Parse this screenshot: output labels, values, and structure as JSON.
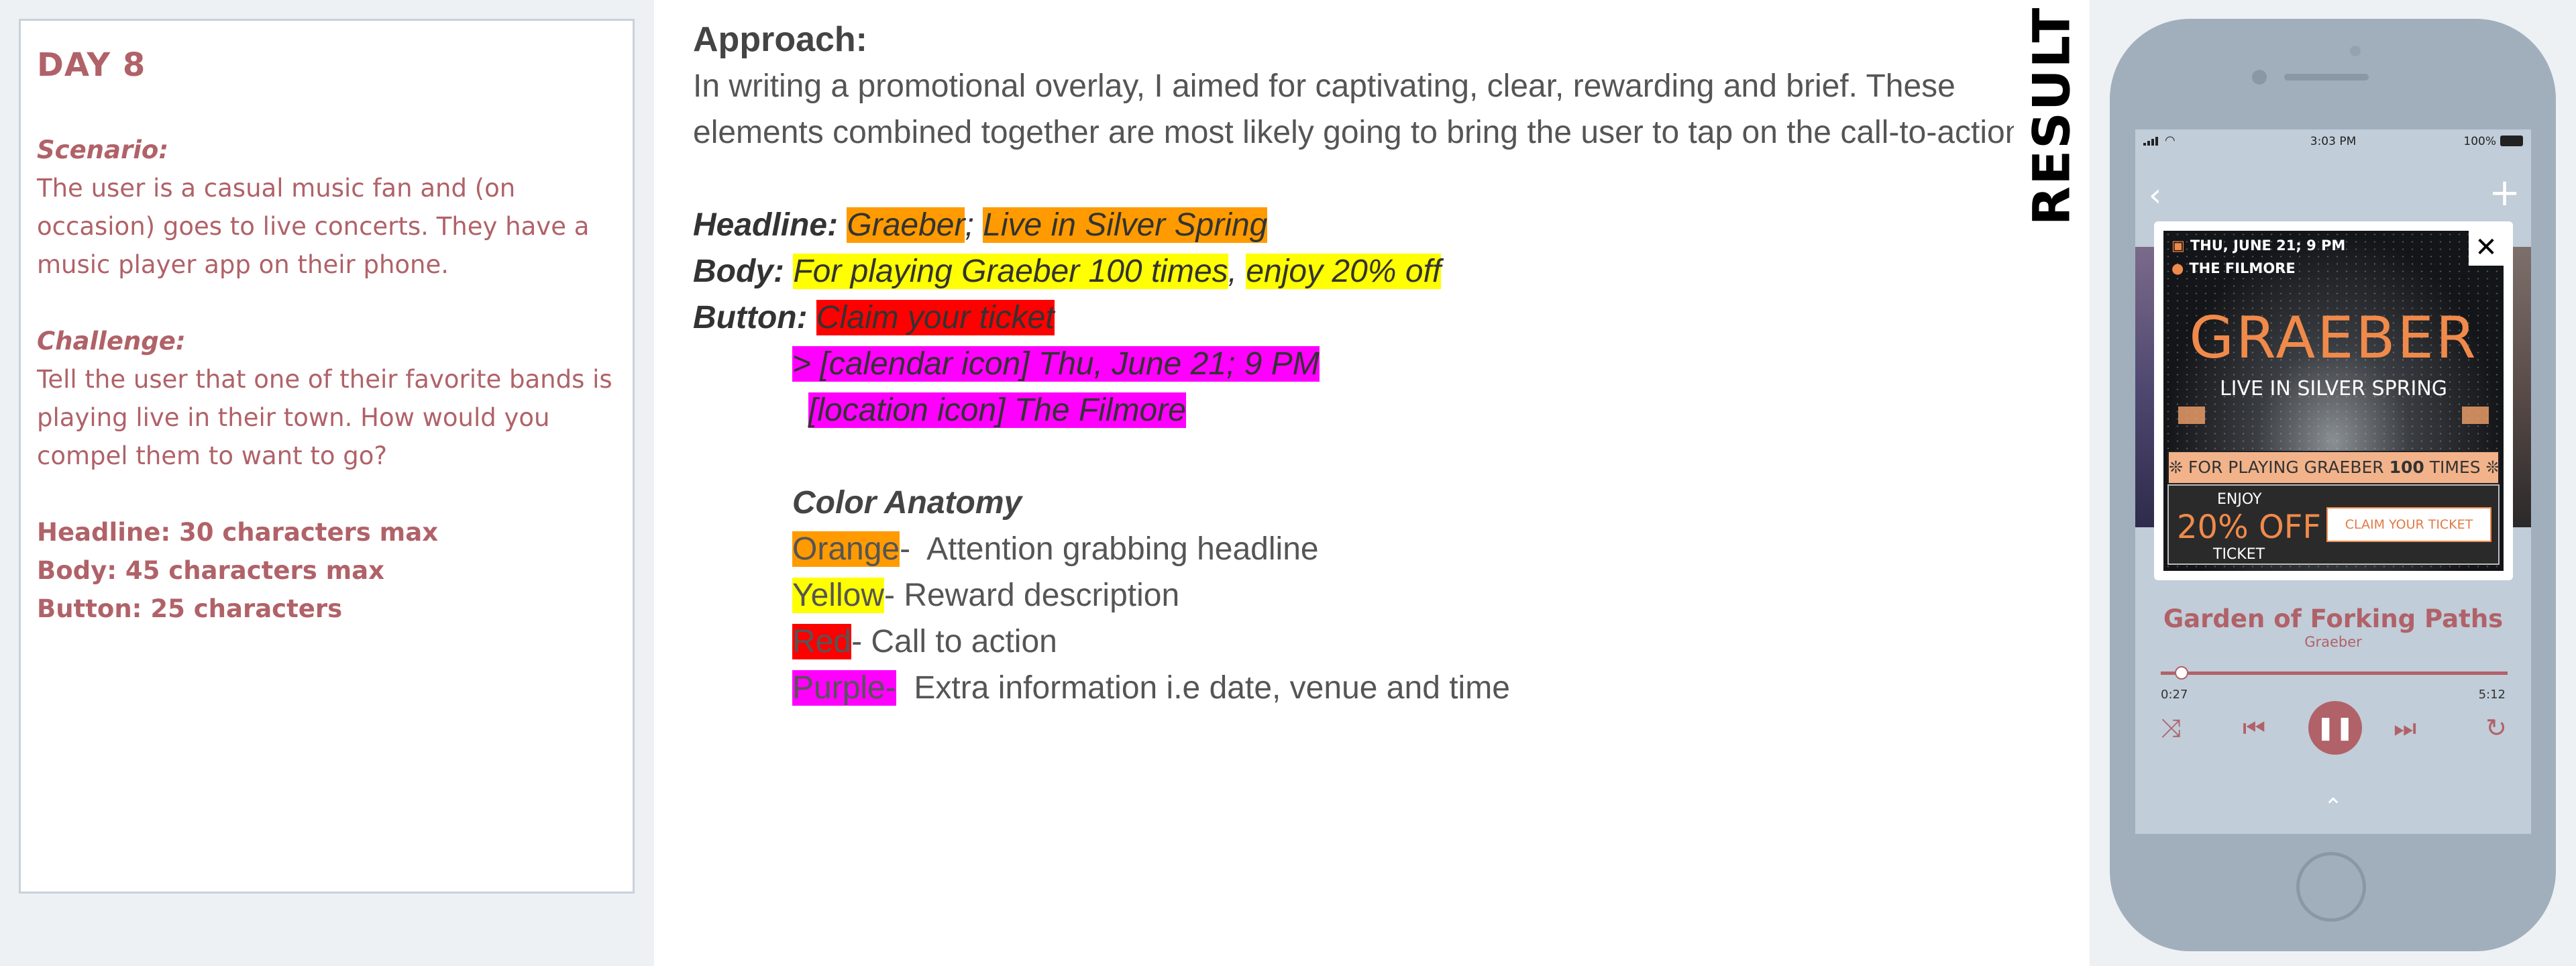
{
  "brief": {
    "day": "DAY 8",
    "scenario_heading": "Scenario:",
    "scenario_text": "The user is a casual music fan and (on occasion) goes to live concerts. They have a music player app on their phone.",
    "challenge_heading": "Challenge:",
    "challenge_text": "Tell the user that one of their favorite bands is playing live in their town. How would you compel them to want to go?",
    "headline_req": "Headline: 30 characters max",
    "body_req": "Body: 45 characters max",
    "button_req": "Button: 25 characters"
  },
  "approach": {
    "title": "Approach:",
    "intro": "In writing a promotional overlay, I aimed for captivating, clear, rewarding and brief. These elements combined together are most likely going to bring the user to tap on the call-to-action.",
    "headline_label": "Headline:",
    "headline_part1": "Graeber",
    "headline_sep": ";",
    "headline_part2": "Live in Silver Spring",
    "body_label": "Body:",
    "body_part1": "For playing Graeber 100 times",
    "body_sep": ",",
    "body_part2": "enjoy 20% off",
    "button_label": "Button:",
    "button_text": "Claim your ticket",
    "extra1": "> [calendar icon] Thu, June 21; 9 PM",
    "extra2": "[location icon] The Filmore",
    "anatomy_title": "Color Anatomy",
    "anatomy": [
      {
        "swatch": "Orange",
        "sep": "-",
        "desc": "  Attention grabbing headline",
        "color": "#ff9b00"
      },
      {
        "swatch": "Yellow",
        "sep": "-",
        "desc": " Reward description",
        "color": "#ffff00"
      },
      {
        "swatch": "Red",
        "sep": "-",
        "desc": " Call to action",
        "color": "#ff0000"
      },
      {
        "swatch": "Purple",
        "sep": "-",
        "desc": "  Extra information i.e date, venue and time",
        "color": "#ff00ff"
      }
    ]
  },
  "result_label": "RESULT",
  "phone": {
    "status_time": "3:03 PM",
    "battery": "100%",
    "overlay": {
      "date": "THU, JUNE 21; 9 PM",
      "venue": "THE FILMORE",
      "band": "GRAEBER",
      "subtitle": "LIVE IN SILVER SPRING",
      "offer_prefix": "FOR PLAYING GRAEBER ",
      "offer_count": "100",
      "offer_suffix": " TIMES",
      "enjoy": "ENJOY",
      "percent": "20% OFF",
      "ticket": "TICKET",
      "cta": "CLAIM YOUR TICKET",
      "close": "✕"
    },
    "song_title": "Garden of Forking Paths",
    "song_artist": "Graeber",
    "elapsed": "0:27",
    "duration": "5:12",
    "progress": 0.06
  },
  "colors": {
    "accent": "#b06268",
    "overlay_accent": "#f08a4b",
    "phone_body": "#a1afbd",
    "screen_bg": "#c1cdd9"
  }
}
